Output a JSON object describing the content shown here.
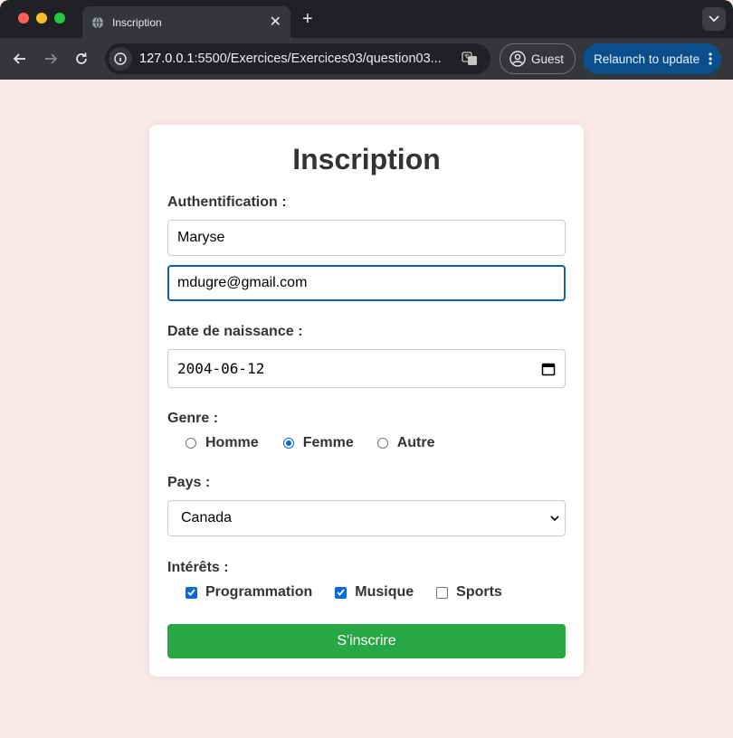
{
  "browser": {
    "tab_title": "Inscription",
    "url_host": "127.0.0.1",
    "url_path": ":5500/Exercices/Exercices03/question03...",
    "guest_label": "Guest",
    "relaunch_label": "Relaunch to update",
    "new_tab_symbol": "+",
    "close_symbol": "✕"
  },
  "form": {
    "title": "Inscription",
    "auth_label": "Authentification :",
    "username_value": "Maryse",
    "email_value": "mdugre@gmail.com",
    "birth_label": "Date de naissance :",
    "birth_value": "2004-06-12",
    "gender_label": "Genre :",
    "gender_options": [
      "Homme",
      "Femme",
      "Autre"
    ],
    "gender_selected": "Femme",
    "country_label": "Pays :",
    "country_value": "Canada",
    "interests_label": "Intérêts :",
    "interests": [
      {
        "label": "Programmation",
        "checked": true
      },
      {
        "label": "Musique",
        "checked": true
      },
      {
        "label": "Sports",
        "checked": false
      }
    ],
    "submit_label": "S'inscrire"
  },
  "colors": {
    "page_background": "#f8e8e9",
    "submit_button": "#28a745",
    "accent": "#0b68d8"
  }
}
